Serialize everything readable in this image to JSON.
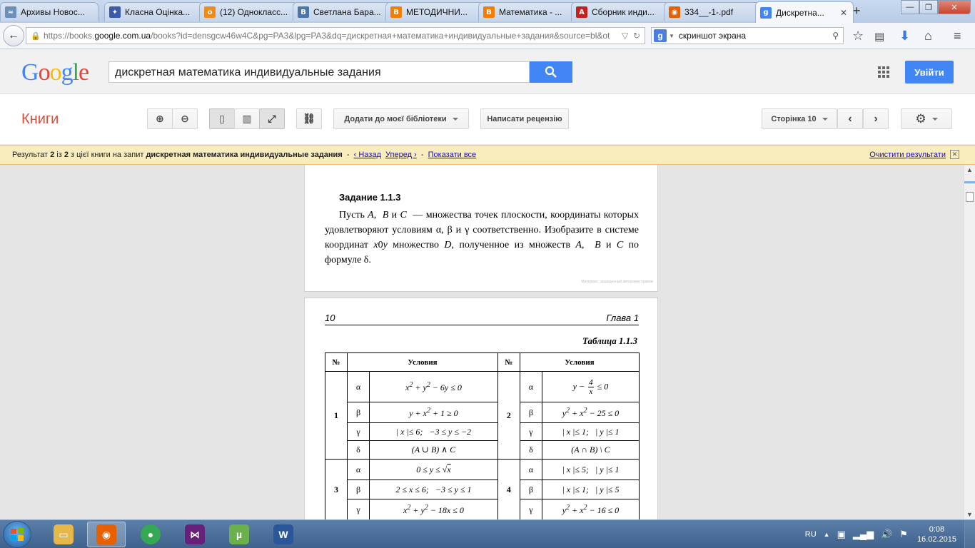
{
  "browser": {
    "tabs": [
      {
        "label": "Архивы Новос...",
        "icon": "globe-favicon",
        "color": "#6b8fb8",
        "glyph": "≈"
      },
      {
        "label": "Класна Оцінка...",
        "icon": "app-favicon",
        "color": "#3b5aa8",
        "glyph": "✦"
      },
      {
        "label": "(12) Однокласс...",
        "icon": "odnoklassniki-favicon",
        "color": "#f28a1a",
        "glyph": "о"
      },
      {
        "label": "Светлана Бара...",
        "icon": "vk-favicon",
        "color": "#4a76a8",
        "glyph": "В"
      },
      {
        "label": "МЕТОДИЧНИ...",
        "icon": "blogger-favicon",
        "color": "#f57d00",
        "glyph": "B"
      },
      {
        "label": "Математика - ...",
        "icon": "blogger-favicon",
        "color": "#f57d00",
        "glyph": "B"
      },
      {
        "label": "Сборник инди...",
        "icon": "pdf-favicon",
        "color": "#c4231d",
        "glyph": "A"
      },
      {
        "label": "334__-1-.pdf",
        "icon": "firefox-pdf-favicon",
        "color": "#e66000",
        "glyph": "◉"
      },
      {
        "label": "Дискретна...",
        "icon": "google-books-favicon",
        "color": "#4285f4",
        "glyph": "g",
        "active": true
      }
    ],
    "url_prefix": "https://books.",
    "url_domain": "google.com.ua",
    "url_rest": "/books?id=densgcw46w4C&pg=PA3&lpg=PA3&dq=дискретная+математика+индивидуальные+задания&source=bl&ot",
    "search_value": "скриншот экрана"
  },
  "google": {
    "logo": "Google",
    "query": "дискретная математика индивидуальные задания",
    "signin_label": "Увійти"
  },
  "books": {
    "section_title": "Книги",
    "add_library_label": "Додати до моєї бібліотеки",
    "review_label": "Написати рецензію",
    "page_label": "Сторінка 10"
  },
  "result_bar": {
    "prefix": "Результат ",
    "current": "2",
    "of": " із ",
    "total": "2",
    "middle": " з цієї книги на запит ",
    "query": "дискретная математика индивидуальные задания",
    "back": "‹ Назад",
    "forward": "Уперед ›",
    "show_all": "Показати все",
    "clear": "Очистити результати"
  },
  "book": {
    "task_title": "Задание 1.1.3",
    "task_text_html": "Пусть <i>A</i>, &nbsp;<i>B</i> и <i>C</i> &nbsp;— множества точек плоскости, координаты которых удовлетворяют условиям α, β и γ соответственно. Изобразите в системе координат <i>x</i>0<i>y</i> множество <i>D</i>, полученное из множеств <i>A</i>, &nbsp;<i>B</i> и <i>C</i> по формуле δ.",
    "copyright": "Материал, защищенный авторским правом",
    "page_number": "10",
    "chapter": "Глава 1",
    "table_caption": "Таблица 1.1.3",
    "col_no": "№",
    "col_cond": "Условия",
    "rows": [
      {
        "variant_left": "1",
        "variant_right": "2"
      },
      {
        "variant_left": "3",
        "variant_right": "4"
      }
    ]
  },
  "taskbar": {
    "apps": [
      {
        "name": "explorer-icon",
        "color": "#e6b84a"
      },
      {
        "name": "firefox-icon",
        "color": "#e66000",
        "active": true
      },
      {
        "name": "chrome-icon",
        "color": "#34a853"
      },
      {
        "name": "visual-studio-icon",
        "color": "#68217a"
      },
      {
        "name": "utorrent-icon",
        "color": "#6ab04c"
      },
      {
        "name": "word-icon",
        "color": "#2b579a"
      }
    ],
    "language": "RU",
    "time": "0:08",
    "date": "16.02.2015"
  }
}
